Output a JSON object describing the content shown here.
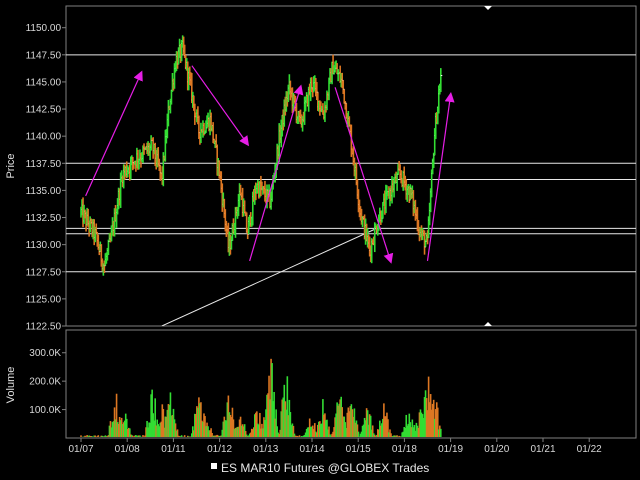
{
  "chart_data": [
    {
      "type": "candlestick",
      "ylabel": "Price",
      "ylim": [
        1122.5,
        1152.0
      ],
      "yticks": [
        "1122.50",
        "1125.00",
        "1127.50",
        "1130.00",
        "1132.50",
        "1135.00",
        "1137.50",
        "1140.00",
        "1142.50",
        "1145.00",
        "1147.50",
        "1150.00"
      ],
      "xticks": [
        "01/07",
        "01/08",
        "01/11",
        "01/12",
        "01/13",
        "01/14",
        "01/15",
        "01/18",
        "01/19",
        "01/20",
        "01/21",
        "01/22"
      ],
      "grid": false,
      "price_path": [
        [
          0,
          1133.0
        ],
        [
          0.3,
          1131.0
        ],
        [
          0.5,
          1128.0
        ],
        [
          0.65,
          1130.5
        ],
        [
          0.9,
          1136.5
        ],
        [
          1.2,
          1138.0
        ],
        [
          1.55,
          1139.0
        ],
        [
          1.75,
          1136.0
        ],
        [
          1.9,
          1142.5
        ],
        [
          2.05,
          1147.0
        ],
        [
          2.2,
          1148.0
        ],
        [
          2.35,
          1145.0
        ],
        [
          2.55,
          1140.5
        ],
        [
          2.8,
          1141.5
        ],
        [
          3.0,
          1136.5
        ],
        [
          3.2,
          1129.5
        ],
        [
          3.45,
          1135.0
        ],
        [
          3.6,
          1131.0
        ],
        [
          3.8,
          1135.5
        ],
        [
          4.1,
          1134.0
        ],
        [
          4.3,
          1140.0
        ],
        [
          4.5,
          1144.5
        ],
        [
          4.75,
          1141.0
        ],
        [
          5.0,
          1145.0
        ],
        [
          5.25,
          1142.0
        ],
        [
          5.45,
          1146.5
        ],
        [
          5.65,
          1145.0
        ],
        [
          5.85,
          1139.5
        ],
        [
          6.05,
          1133.0
        ],
        [
          6.25,
          1129.5
        ],
        [
          6.45,
          1132.5
        ],
        [
          6.7,
          1135.0
        ],
        [
          6.9,
          1136.5
        ],
        [
          7.15,
          1134.5
        ],
        [
          7.35,
          1131.0
        ],
        [
          7.5,
          1130.0
        ],
        [
          7.65,
          1140.0
        ],
        [
          7.8,
          1146.0
        ]
      ],
      "horizontal_lines": [
        1147.5,
        1137.5,
        1136.0,
        1131.5,
        1131.0,
        1127.5
      ],
      "trendline": [
        [
          1.75,
          1122.5
        ],
        [
          6.4,
          1131.5
        ]
      ],
      "annotation_arrows": [
        [
          [
            0.1,
            1134.5
          ],
          [
            1.3,
            1145.8
          ]
        ],
        [
          [
            2.4,
            1146.5
          ],
          [
            3.6,
            1139.3
          ]
        ],
        [
          [
            3.65,
            1128.5
          ],
          [
            4.75,
            1144.5
          ]
        ],
        [
          [
            5.5,
            1144.5
          ],
          [
            6.7,
            1128.5
          ]
        ],
        [
          [
            7.5,
            1128.5
          ],
          [
            8.0,
            1143.8
          ]
        ]
      ],
      "annotation_color": "#e61ee6"
    },
    {
      "type": "bar",
      "ylabel": "Volume",
      "ylim": [
        0,
        380
      ],
      "yticks": [
        "100.0K",
        "200.0K",
        "300.0K"
      ],
      "volume_spikes": [
        [
          0.75,
          180
        ],
        [
          0.95,
          120
        ],
        [
          1.55,
          210
        ],
        [
          1.75,
          140
        ],
        [
          1.95,
          180
        ],
        [
          2.55,
          180
        ],
        [
          2.7,
          110
        ],
        [
          3.2,
          190
        ],
        [
          3.45,
          120
        ],
        [
          3.8,
          150
        ],
        [
          4.1,
          340
        ],
        [
          4.45,
          290
        ],
        [
          5.0,
          110
        ],
        [
          5.25,
          160
        ],
        [
          5.6,
          200
        ],
        [
          5.85,
          190
        ],
        [
          6.2,
          130
        ],
        [
          6.55,
          160
        ],
        [
          7.1,
          130
        ],
        [
          7.35,
          120
        ],
        [
          7.5,
          260
        ],
        [
          7.65,
          180
        ]
      ]
    }
  ],
  "footer": {
    "marker_color": "#ffffff",
    "text": "ES MAR10 Futures @GLOBEX Trades"
  },
  "colors": {
    "background": "#000000",
    "up_bar": "#33dd33",
    "down_bar": "#dd7722",
    "frame": "#7f7f7f",
    "level_line": "#e8e8e8"
  }
}
